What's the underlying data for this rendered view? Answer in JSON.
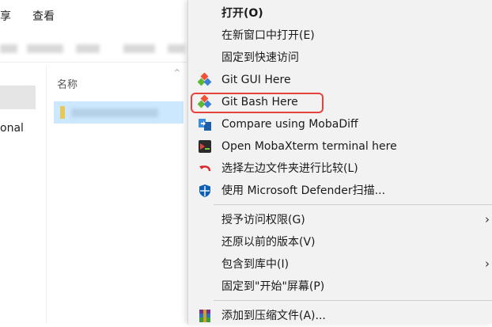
{
  "explorer": {
    "ribbon_tabs": [
      "享",
      "查看"
    ],
    "nav_label": "onal",
    "column_header": "名称",
    "sort_arrow": "^"
  },
  "menu": {
    "items": [
      {
        "label": "打开(O)",
        "bold": true,
        "icon": ""
      },
      {
        "label": "在新窗口中打开(E)",
        "icon": ""
      },
      {
        "label": "固定到快速访问",
        "icon": ""
      },
      {
        "label": "Git GUI Here",
        "icon": "git-gui-icon"
      },
      {
        "label": "Git Bash Here",
        "icon": "git-bash-icon",
        "highlighted": true
      },
      {
        "label": "Compare using MobaDiff",
        "icon": "mobadiff-icon"
      },
      {
        "label": "Open MobaXterm terminal here",
        "icon": "mobaxterm-icon"
      },
      {
        "label": "选择左边文件夹进行比较(L)",
        "icon": "compare-left-icon"
      },
      {
        "label": "使用 Microsoft Defender扫描...",
        "icon": "defender-shield-icon"
      },
      {
        "label": "授予访问权限(G)",
        "icon": "",
        "submenu": true
      },
      {
        "label": "还原以前的版本(V)",
        "icon": ""
      },
      {
        "label": "包含到库中(I)",
        "icon": "",
        "submenu": true
      },
      {
        "label": "固定到\"开始\"屏幕(P)",
        "icon": ""
      },
      {
        "label": "添加到压缩文件(A)...",
        "icon": "winrar-icon"
      }
    ],
    "submenu_arrow": "›",
    "highlight_color": "#e8423c"
  },
  "colors": {
    "menu_bg": "#f2f2f2",
    "selection_bg": "#cce8ff",
    "git_orange": "#f05033",
    "git_green": "#5fb832",
    "defender_blue": "#0a5fb4"
  }
}
